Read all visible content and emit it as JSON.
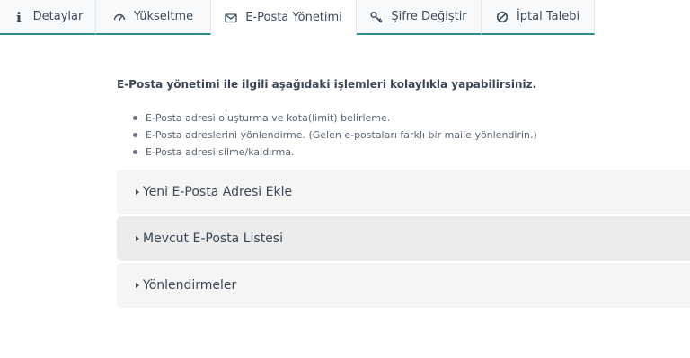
{
  "tabs": [
    {
      "label": "Detaylar",
      "icon": "info-icon",
      "active": false
    },
    {
      "label": "Yükseltme",
      "icon": "gauge-icon",
      "active": false
    },
    {
      "label": "E-Posta Yönetimi",
      "icon": "envelope-icon",
      "active": true
    },
    {
      "label": "Şifre Değiştir",
      "icon": "key-icon",
      "active": false
    },
    {
      "label": "İptal Talebi",
      "icon": "ban-icon",
      "active": false
    }
  ],
  "intro": "E-Posta yönetimi ile ilgili aşağıdaki işlemleri kolaylıkla yapabilirsiniz.",
  "bullets": [
    "E-Posta adresi oluşturma ve kota(limit) belirleme.",
    "E-Posta adreslerini yönlendirme. (Gelen e-postaları farklı bir maile yönlendirin.)",
    "E-Posta adresi silme/kaldırma."
  ],
  "panels": [
    {
      "label": "Yeni E-Posta Adresi Ekle"
    },
    {
      "label": "Mevcut E-Posta Listesi"
    },
    {
      "label": "Yönlendirmeler"
    }
  ],
  "colors": {
    "accent": "#2a8f92",
    "panel": "#f5f5f5",
    "panel_hover": "#ececec"
  }
}
